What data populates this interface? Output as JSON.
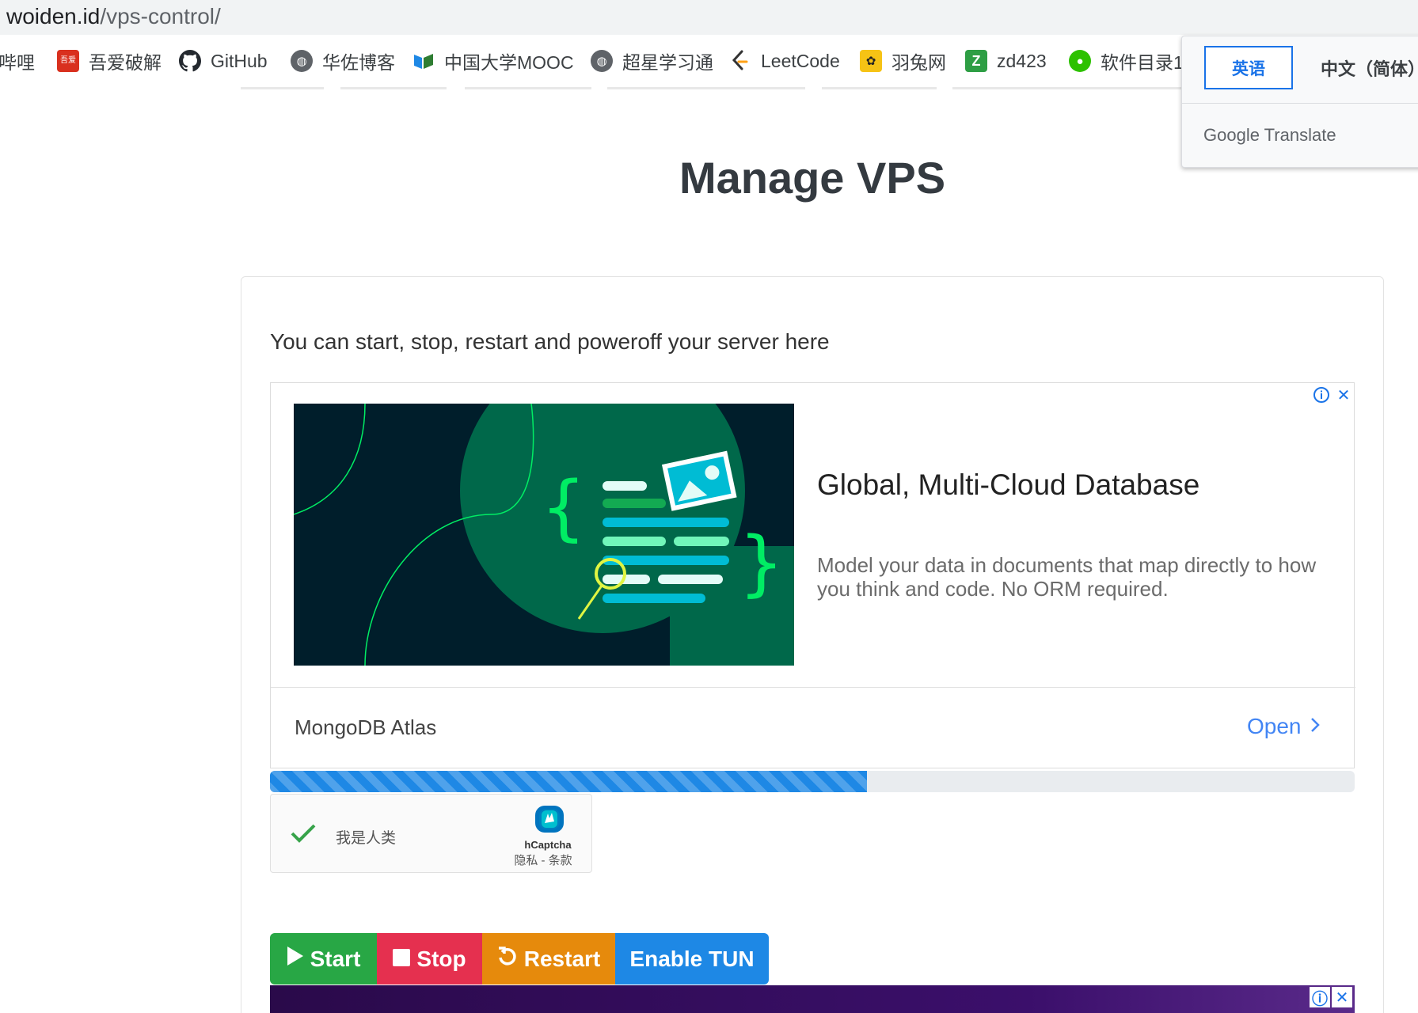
{
  "browser": {
    "url_host": "woiden.id",
    "url_path": "/vps-control/",
    "bookmarks": [
      {
        "label": "哔哩",
        "icon": "bilibili-icon"
      },
      {
        "label": "吾爱破解",
        "icon": "52pojie-icon"
      },
      {
        "label": "GitHub",
        "icon": "github-icon"
      },
      {
        "label": "华佐博客",
        "icon": "globe-icon"
      },
      {
        "label": "中国大学MOOC",
        "icon": "mooc-icon"
      },
      {
        "label": "超星学习通",
        "icon": "globe-icon"
      },
      {
        "label": "LeetCode",
        "icon": "leetcode-icon"
      },
      {
        "label": "羽兔网",
        "icon": "yutu-icon"
      },
      {
        "label": "zd423",
        "icon": "zd423-icon"
      },
      {
        "label": "软件目录1",
        "icon": "wechat-icon"
      }
    ]
  },
  "translate": {
    "lang_en": "英语",
    "lang_zh": "中文（简体）",
    "brand_google": "Google",
    "brand_translate": "Translate"
  },
  "page": {
    "title": "Manage VPS",
    "description": "You can start, stop, restart and poweroff your server here"
  },
  "ad": {
    "headline": "Global, Multi-Cloud Database",
    "body": "Model your data in documents that map directly to how you think and code. No ORM required.",
    "advertiser": "MongoDB Atlas",
    "cta": "Open",
    "accent_color": "#00ed64"
  },
  "progress": {
    "percent": 55,
    "color": "#1e88e5"
  },
  "captcha": {
    "label": "我是人类",
    "brand": "hCaptcha",
    "links": "隐私 - 条款"
  },
  "buttons": {
    "start": "Start",
    "stop": "Stop",
    "restart": "Restart",
    "enable_tun": "Enable TUN"
  }
}
